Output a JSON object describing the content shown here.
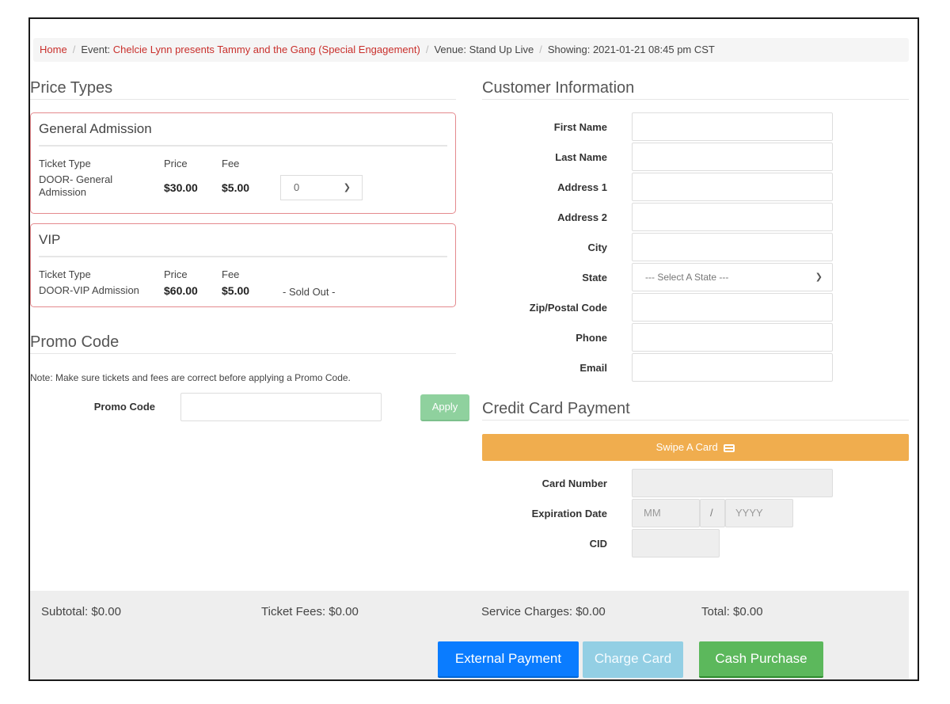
{
  "breadcrumb": {
    "home": "Home",
    "event_prefix": "Event: ",
    "event_name": "Chelcie Lynn presents Tammy and the Gang (Special Engagement)",
    "venue": "Venue: Stand Up Live",
    "showing": "Showing: 2021-01-21 08:45 pm CST"
  },
  "price_types": {
    "heading": "Price Types",
    "column_headers": {
      "ticket_type": "Ticket Type",
      "price": "Price",
      "fee": "Fee"
    },
    "groups": [
      {
        "title": "General Admission",
        "ticket_type_line1": "DOOR- General",
        "ticket_type_line2": "Admission",
        "price": "$30.00",
        "fee": "$5.00",
        "quantity": "0"
      },
      {
        "title": "VIP",
        "ticket_type": "DOOR-VIP Admission",
        "price": "$60.00",
        "fee": "$5.00",
        "status": "- Sold Out -"
      }
    ]
  },
  "promo": {
    "heading": "Promo Code",
    "note": "Note: Make sure tickets and fees are correct before applying a Promo Code.",
    "label": "Promo Code",
    "value": "",
    "apply_label": "Apply"
  },
  "customer": {
    "heading": "Customer Information",
    "fields": {
      "first_name": "First Name",
      "last_name": "Last Name",
      "address1": "Address 1",
      "address2": "Address 2",
      "city": "City",
      "state": "State",
      "zip": "Zip/Postal Code",
      "phone": "Phone",
      "email": "Email"
    },
    "state_selected": "--- Select A State ---"
  },
  "payment": {
    "heading": "Credit Card Payment",
    "swipe_label": "Swipe A Card",
    "card_number_label": "Card Number",
    "expiration_label": "Expiration Date",
    "month_placeholder": "MM",
    "separator": "/",
    "year_placeholder": "YYYY",
    "cid_label": "CID"
  },
  "totals": {
    "subtotal": "Subtotal: $0.00",
    "ticket_fees": "Ticket Fees: $0.00",
    "service_charges": "Service Charges: $0.00",
    "total": "Total: $0.00"
  },
  "actions": {
    "external_payment": "External Payment",
    "charge_card": "Charge Card",
    "cash_purchase": "Cash Purchase"
  },
  "colors": {
    "link_red": "#c9302c",
    "swipe_orange": "#f0ad4e",
    "external_blue": "#0a7cff",
    "charge_light_blue": "#93cfe4",
    "cash_green": "#5cb85c",
    "apply_green": "#8fd19e",
    "box_border": "#e48a8e"
  }
}
